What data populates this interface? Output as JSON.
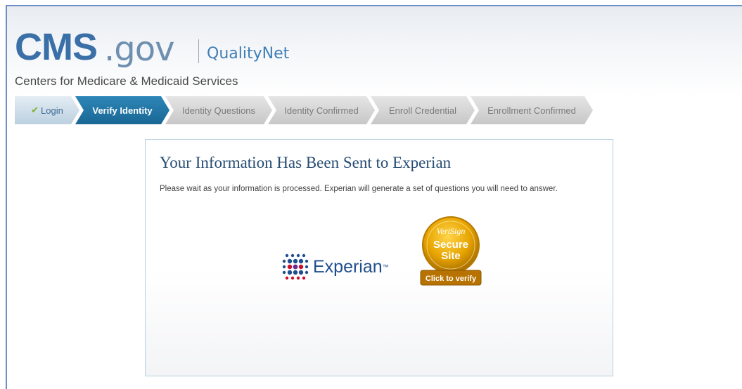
{
  "header": {
    "logo_cms": "CMS",
    "logo_gov": ".gov",
    "logo_qualitynet": "QualityNet",
    "subtitle": "Centers for Medicare & Medicaid Services"
  },
  "steps": [
    {
      "label": "Login",
      "state": "done"
    },
    {
      "label": "Verify Identity",
      "state": "active"
    },
    {
      "label": "Identity Questions",
      "state": "todo"
    },
    {
      "label": "Identity Confirmed",
      "state": "todo"
    },
    {
      "label": "Enroll Credential",
      "state": "todo"
    },
    {
      "label": "Enrollment Confirmed",
      "state": "todo"
    }
  ],
  "main": {
    "title": "Your Information Has Been Sent to Experian",
    "message": "Please wait as your information is processed. Experian will generate a set of questions you will need to answer.",
    "experian_logo": "Experian",
    "experian_tm": "™",
    "verisign_brand": "VeriSign",
    "verisign_line1": "Secure",
    "verisign_line2": "Site",
    "verisign_cta": "Click to verify"
  },
  "colors": {
    "accent": "#1a6795",
    "brand": "#3a6fa8",
    "step_done": "#bcd0e0",
    "step_todo": "#c7c7c7",
    "verisign_gold": "#e7a400"
  }
}
